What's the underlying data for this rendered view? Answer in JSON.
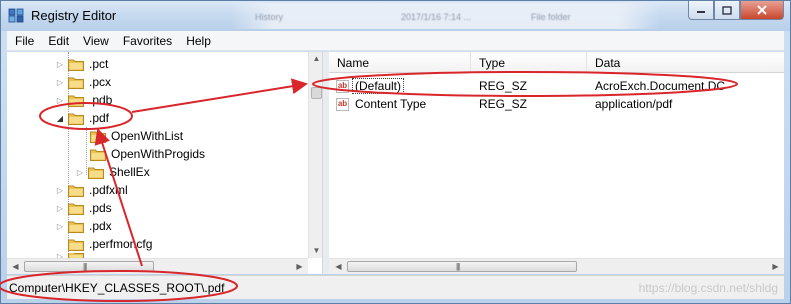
{
  "window": {
    "title": "Registry Editor"
  },
  "background_text": {
    "a": "History",
    "b": "2017/1/16 7:14 ...",
    "c": "File folder"
  },
  "menu": [
    "File",
    "Edit",
    "View",
    "Favorites",
    "Help"
  ],
  "tree": {
    "items": [
      {
        "label": ".pct",
        "state": "collapsed"
      },
      {
        "label": ".pcx",
        "state": "collapsed"
      },
      {
        "label": ".pdb",
        "state": "collapsed"
      },
      {
        "label": ".pdf",
        "state": "expanded"
      },
      {
        "label": "OpenWithList",
        "state": "leaf"
      },
      {
        "label": "OpenWithProgids",
        "state": "leaf"
      },
      {
        "label": "ShellEx",
        "state": "collapsed"
      },
      {
        "label": ".pdfxml",
        "state": "collapsed"
      },
      {
        "label": ".pds",
        "state": "collapsed"
      },
      {
        "label": ".pdx",
        "state": "collapsed"
      },
      {
        "label": ".perfmoncfg",
        "state": "leaf"
      }
    ]
  },
  "list": {
    "columns": [
      "Name",
      "Type",
      "Data"
    ],
    "rows": [
      {
        "name": "(Default)",
        "type": "REG_SZ",
        "data": "AcroExch.Document.DC"
      },
      {
        "name": "Content Type",
        "type": "REG_SZ",
        "data": "application/pdf"
      }
    ]
  },
  "status": {
    "path": "Computer\\HKEY_CLASSES_ROOT\\.pdf"
  },
  "watermark": "https://blog.csdn.net/shldg",
  "colors": {
    "annotation_red": "#d9262b",
    "folder_yellow": "#e9c252",
    "titlebar": "#c5d9ef"
  }
}
